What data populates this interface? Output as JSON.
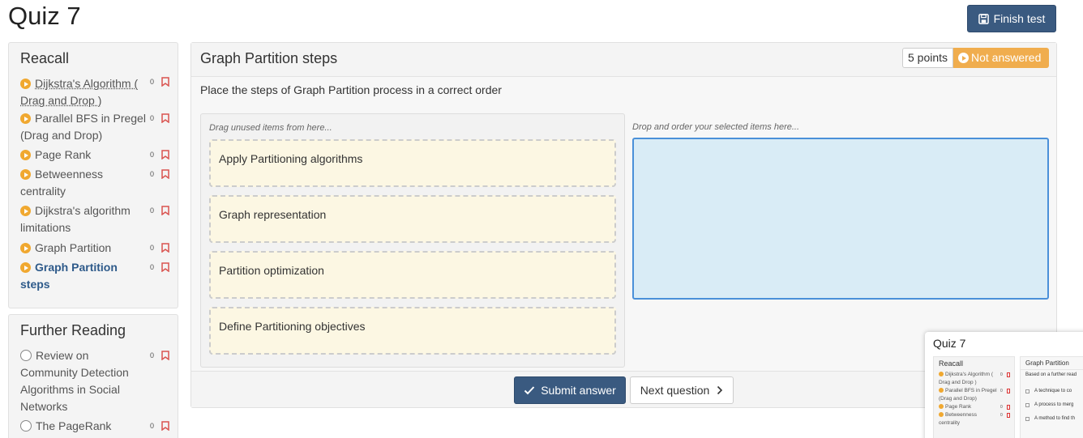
{
  "page": {
    "title": "Quiz 7",
    "finish_label": "Finish test"
  },
  "sidebar": {
    "recall": {
      "title": "Reacall",
      "items": [
        {
          "label": "Dijkstra's Algorithm ( Drag and Drop )",
          "count": "0"
        },
        {
          "label": "Parallel BFS in Pregel (Drag and Drop)",
          "count": "0"
        },
        {
          "label": "Page Rank",
          "count": "0"
        },
        {
          "label": "Betweenness centrality",
          "count": "0"
        },
        {
          "label": "Dijkstra's algorithm limitations",
          "count": "0"
        },
        {
          "label": "Graph Partition",
          "count": "0"
        },
        {
          "label": "Graph Partition steps",
          "count": "0"
        }
      ]
    },
    "further": {
      "title": "Further Reading",
      "items": [
        {
          "label": "Review on Community Detection Algorithms in Social Networks",
          "count": "0"
        },
        {
          "label": "The PageRank",
          "count": "0"
        }
      ]
    }
  },
  "question": {
    "title": "Graph Partition steps",
    "points": "5 points",
    "status": "Not answered",
    "text": "Place the steps of Graph Partition process in a correct order",
    "source_hint": "Drag unused items from here...",
    "target_hint": "Drop and order your selected items here...",
    "items": [
      "Apply Partitioning algorithms",
      "Graph representation",
      "Partition optimization",
      "Define Partitioning objectives"
    ],
    "submit_label": "Submit answer",
    "next_label": "Next question"
  },
  "thumbnail": {
    "title": "Quiz 7",
    "side_title": "Reacall",
    "side_items": [
      "Dijkstra's Algorithm (",
      "Drag and Drop )",
      "Parallel BFS in Pregel",
      "(Drag and Drop)",
      "Page Rank",
      "Betweenness",
      "centrality"
    ],
    "main_title": "Graph Partition",
    "main_text": "Based on a further read",
    "options": [
      "A technique to co",
      "A process to merg",
      "A method to find th"
    ]
  },
  "colors": {
    "primary": "#3a5a80",
    "warning": "#f0ad4e",
    "drag_item_bg": "#fcf7e3",
    "drop_zone_bg": "#d9ecf6"
  }
}
